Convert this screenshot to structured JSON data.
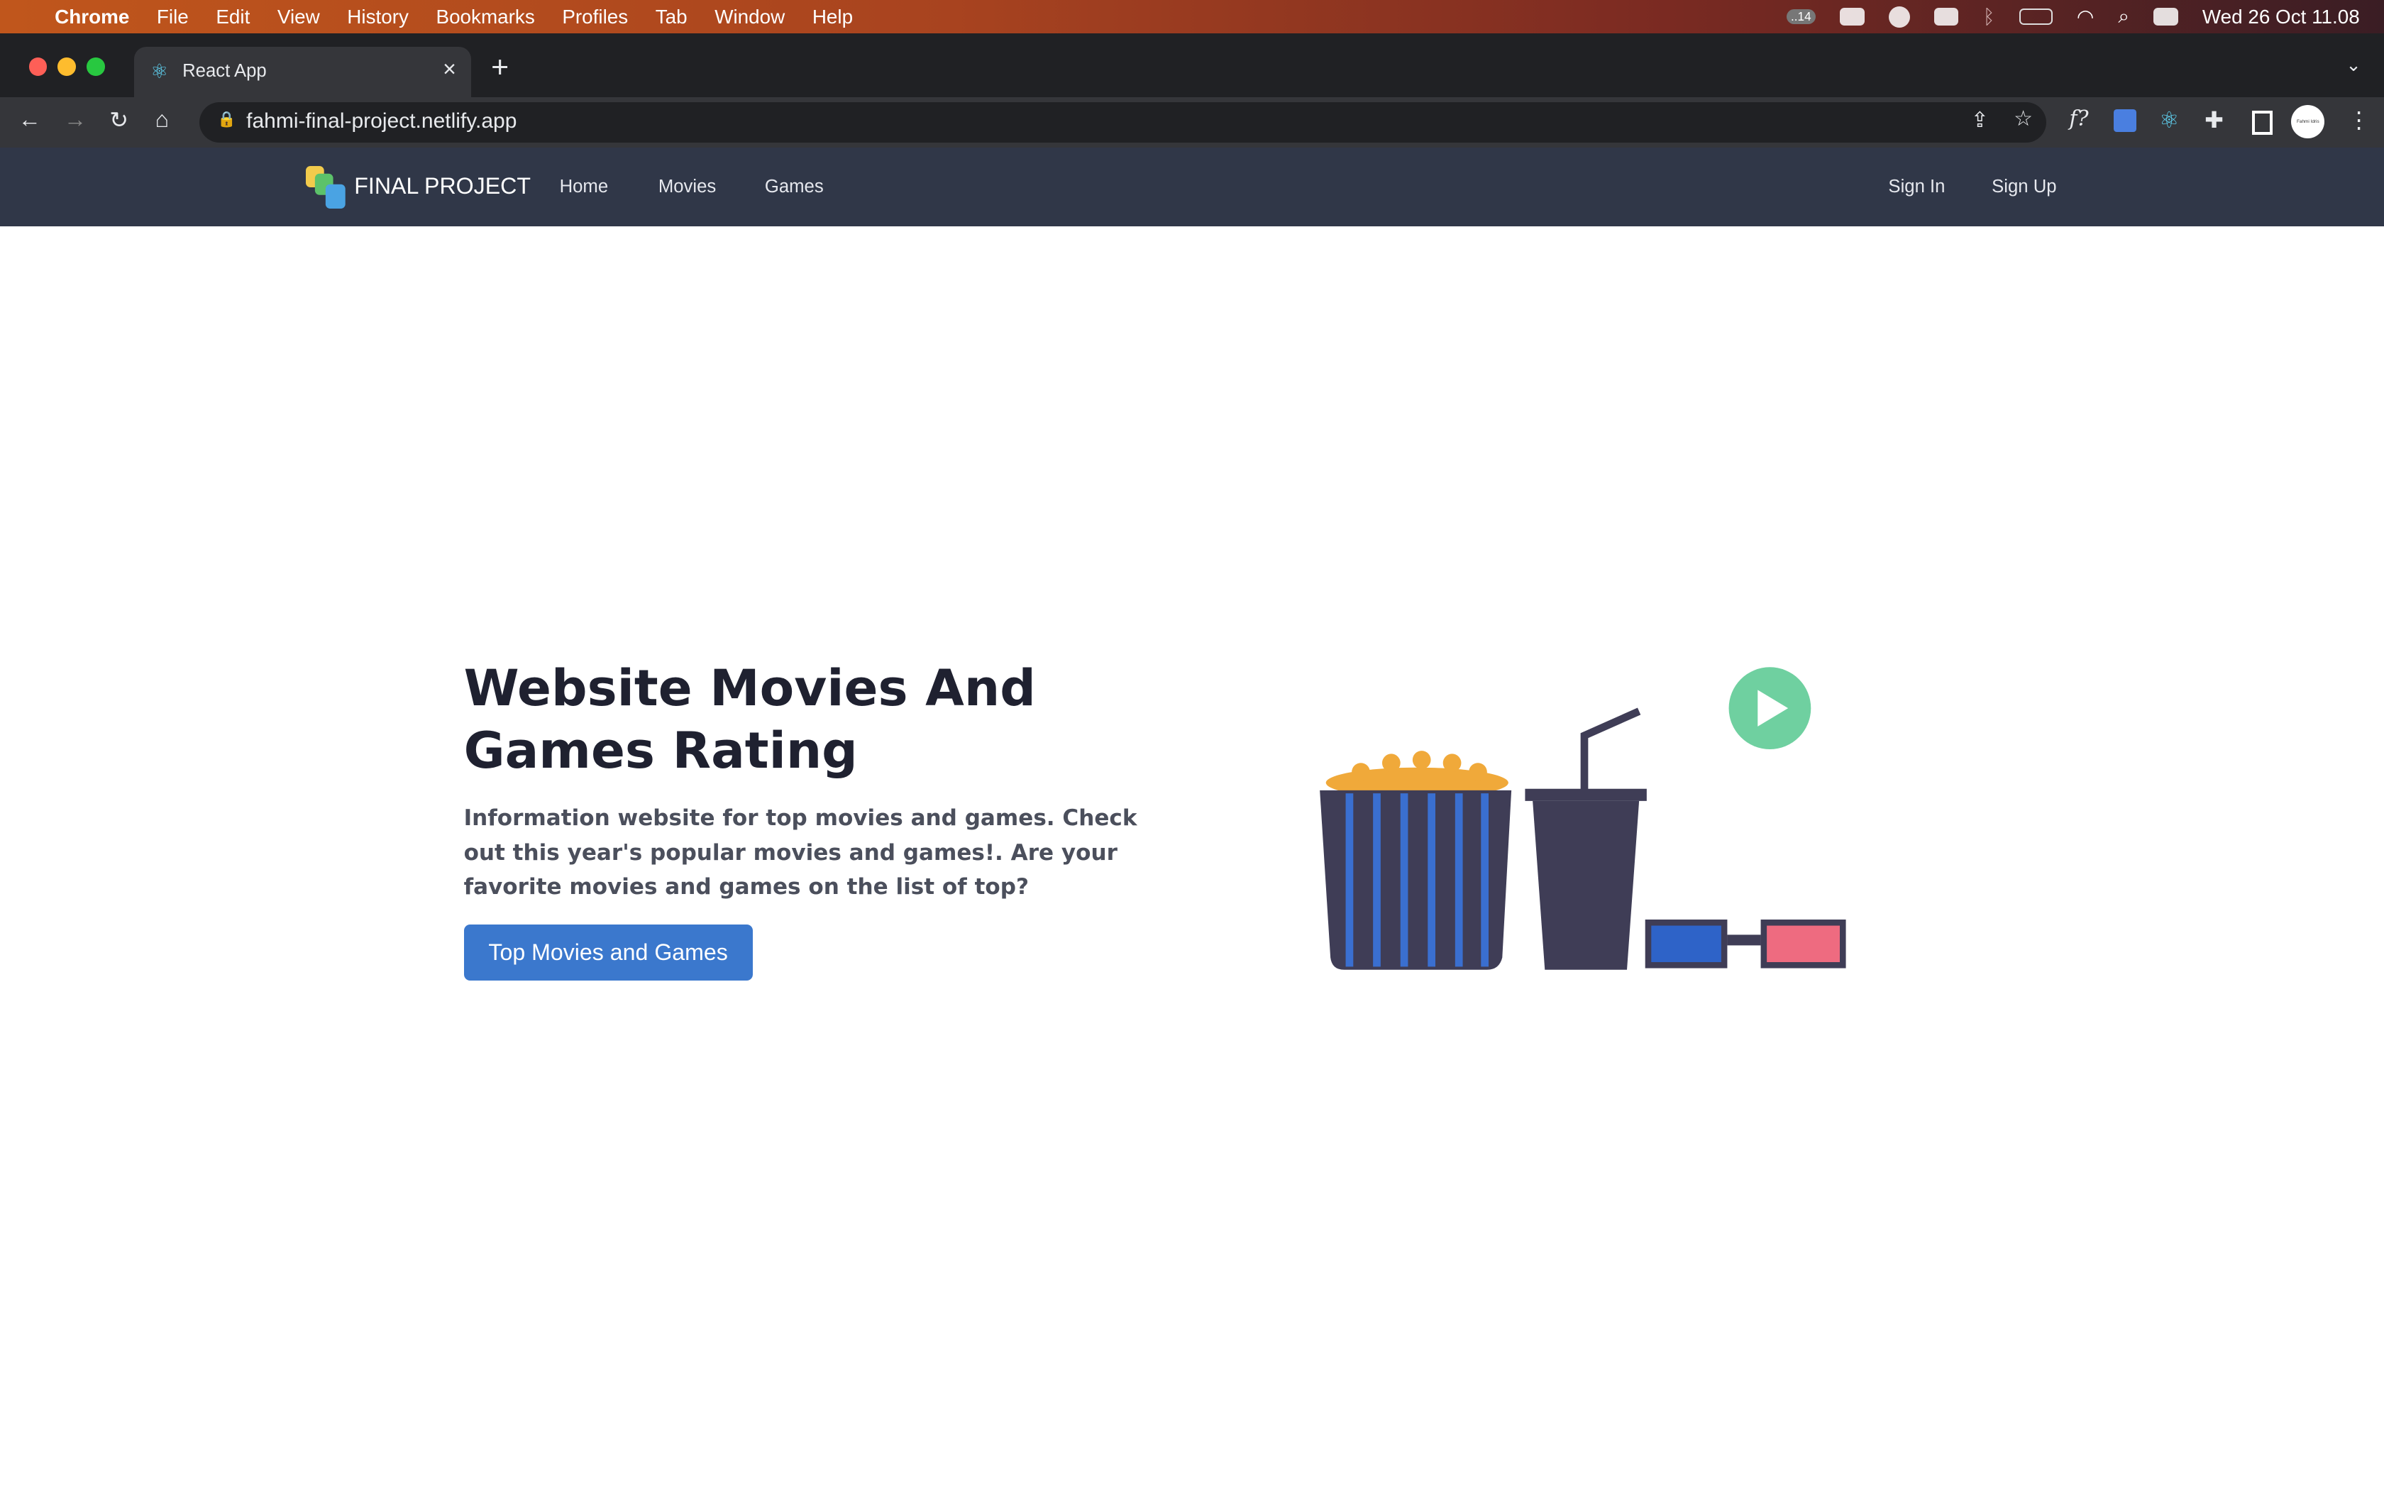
{
  "menubar": {
    "app": "Chrome",
    "items": [
      "File",
      "Edit",
      "View",
      "History",
      "Bookmarks",
      "Profiles",
      "Tab",
      "Window",
      "Help"
    ],
    "clock": "Wed 26 Oct  11.08",
    "badge": "..14"
  },
  "browser": {
    "tab_title": "React App",
    "url": "fahmi-final-project.netlify.app",
    "avatar_text": "Fahmi Idris"
  },
  "nav": {
    "brand": "FINAL PROJECT",
    "links": [
      "Home",
      "Movies",
      "Games"
    ],
    "sign_in": "Sign In",
    "sign_up": "Sign Up"
  },
  "hero": {
    "title": "Website Movies And Games Rating",
    "description": "Information website for top movies and games. Check out this year's popular movies and games!. Are your favorite movies and games on the list of top?",
    "cta": "Top Movies and Games"
  },
  "colors": {
    "nav_bg": "#303748",
    "button": "#3b78cd",
    "play": "#6fd0a0",
    "popcorn": "#f0a93a",
    "stripe": "#3a6fd0",
    "dark": "#3f3d56",
    "lens_left": "#2e63c8",
    "lens_right": "#ee6b80"
  }
}
